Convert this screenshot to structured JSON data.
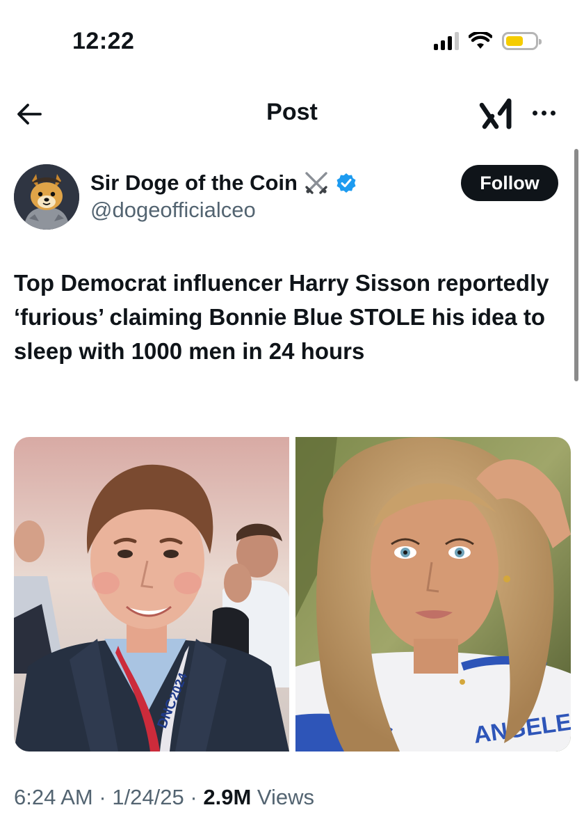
{
  "status_bar": {
    "time": "12:22",
    "battery_color": "#f5cc00",
    "battery_level": 0.6,
    "icons": [
      "signal-icon",
      "wifi-icon",
      "battery-icon"
    ]
  },
  "header": {
    "title": "Post",
    "icons": [
      "back-arrow-icon",
      "grok-icon",
      "more-icon"
    ]
  },
  "author": {
    "name": "Sir Doge of the Coin",
    "name_emoji": "crossed-swords-icon",
    "verified_badge": "verified-badge-icon",
    "verified_color": "#1d9bf0",
    "handle": "@dogeofficialceo"
  },
  "follow_label": "Follow",
  "tweet": {
    "text": "Top Democrat influencer Harry Sisson reportedly ‘furious’ claiming Bonnie Blue STOLE his idea to sleep with 1000 men in 24 hours"
  },
  "media": {
    "left_badge_text": "DNC",
    "left_badge_text2": "2024",
    "right_shirt_text": "ANGELES"
  },
  "meta": {
    "time": "6:24 AM",
    "date": "1/24/25",
    "views_count": "2.9M",
    "views_label": "Views",
    "sep": "·"
  }
}
